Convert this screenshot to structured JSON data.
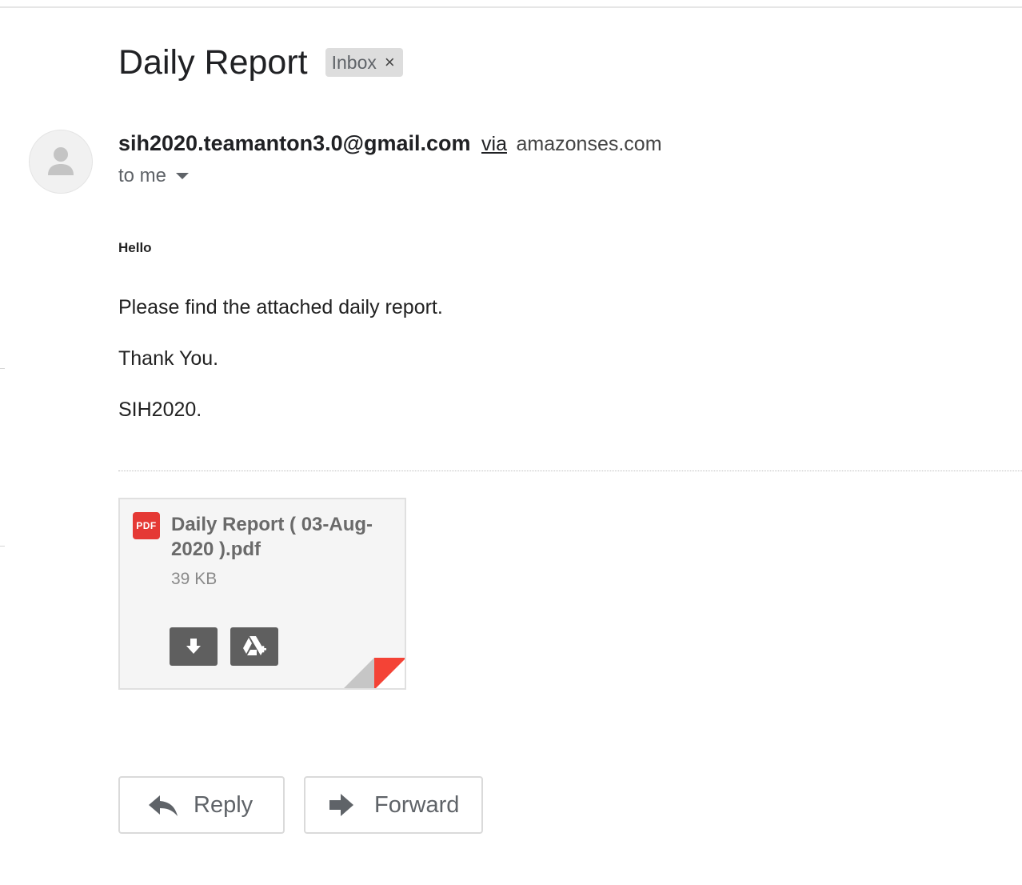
{
  "email": {
    "subject": "Daily Report",
    "label": "Inbox",
    "label_remove": "×",
    "sender_email": "sih2020.teamanton3.0@gmail.com",
    "via_text": "via",
    "via_domain": "amazonses.com",
    "recipient": "to me",
    "body": {
      "greeting": "Hello",
      "line1": "Please find the attached daily report.",
      "line2": "Thank You.",
      "line3": "SIH2020."
    }
  },
  "attachment": {
    "type_badge": "PDF",
    "filename": "Daily Report ( 03-Aug-2020 ).pdf",
    "size": "39 KB"
  },
  "actions": {
    "reply_label": "Reply",
    "forward_label": "Forward"
  },
  "icons": {
    "avatar": "person-icon",
    "download": "download-icon",
    "drive": "add-to-drive-icon",
    "reply": "reply-arrow-icon",
    "forward": "forward-arrow-icon"
  },
  "colors": {
    "pdf_badge": "#e53935",
    "fold_accent": "#f44336",
    "chip_bg": "#dddddd",
    "button_dark": "#5f5f5f"
  }
}
